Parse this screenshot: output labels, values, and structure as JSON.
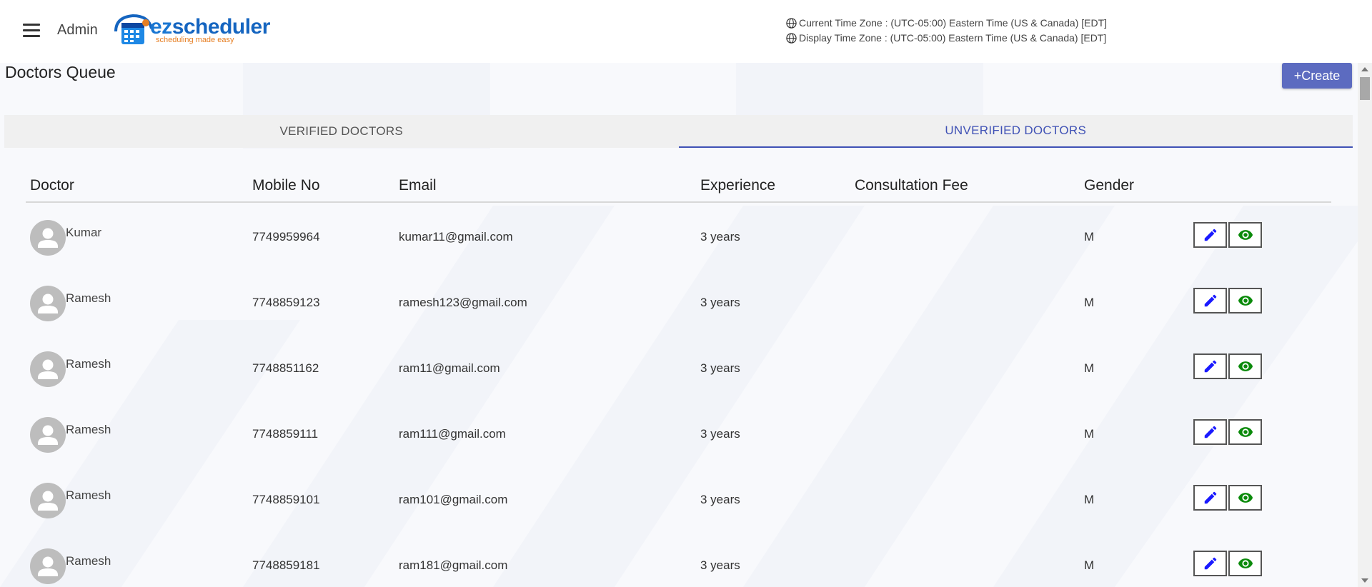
{
  "header": {
    "admin_label": "Admin",
    "logo": {
      "brand_ez": "ez",
      "brand_rest": "scheduler",
      "tagline": "scheduling made easy"
    },
    "current_timezone": "Current Time Zone : (UTC-05:00) Eastern Time (US & Canada) [EDT]",
    "display_timezone": "Display Time Zone : (UTC-05:00) Eastern Time (US & Canada) [EDT]"
  },
  "page": {
    "title": "Doctors Queue",
    "create_label": "+Create"
  },
  "tabs": [
    {
      "label": "VERIFIED DOCTORS",
      "active": false
    },
    {
      "label": "UNVERIFIED DOCTORS",
      "active": true
    }
  ],
  "table": {
    "columns": [
      "Doctor",
      "Mobile No",
      "Email",
      "Experience",
      "Consultation Fee",
      "Gender"
    ],
    "rows": [
      {
        "doctor": "Kumar",
        "mobile": "7749959964",
        "email": "kumar11@gmail.com",
        "experience": "3 years",
        "fee": "",
        "gender": "M"
      },
      {
        "doctor": "Ramesh",
        "mobile": "7748859123",
        "email": "ramesh123@gmail.com",
        "experience": "3 years",
        "fee": "",
        "gender": "M"
      },
      {
        "doctor": "Ramesh",
        "mobile": "7748851162",
        "email": "ram11@gmail.com",
        "experience": "3 years",
        "fee": "",
        "gender": "M"
      },
      {
        "doctor": "Ramesh",
        "mobile": "7748859111",
        "email": "ram111@gmail.com",
        "experience": "3 years",
        "fee": "",
        "gender": "M"
      },
      {
        "doctor": "Ramesh",
        "mobile": "7748859101",
        "email": "ram101@gmail.com",
        "experience": "3 years",
        "fee": "",
        "gender": "M"
      },
      {
        "doctor": "Ramesh",
        "mobile": "7748859181",
        "email": "ram181@gmail.com",
        "experience": "3 years",
        "fee": "",
        "gender": "M"
      }
    ]
  },
  "icons": {
    "menu": "hamburger-icon",
    "globe": "globe-icon",
    "edit": "pencil-icon",
    "view": "eye-icon",
    "avatar": "person-icon"
  },
  "colors": {
    "accent": "#3f51b5",
    "create_button": "#5c6bc0",
    "edit_icon": "#1a1aff",
    "view_icon": "#0a8a0a"
  }
}
